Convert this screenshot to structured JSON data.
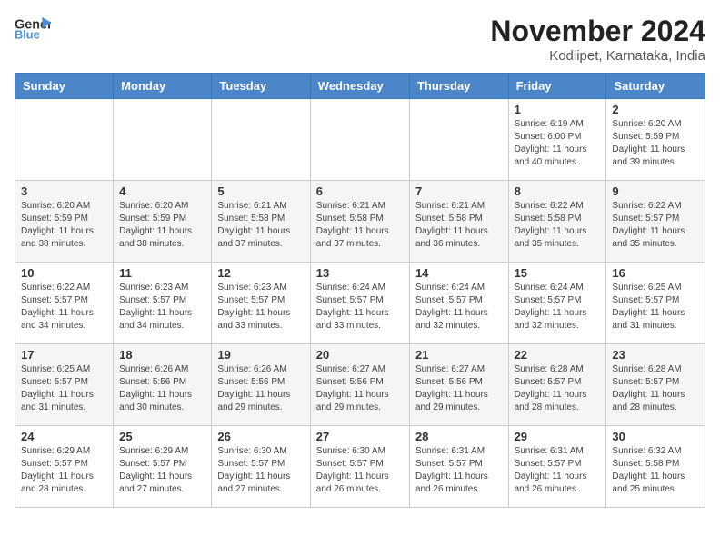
{
  "logo": {
    "general": "General",
    "blue": "Blue"
  },
  "title": "November 2024",
  "subtitle": "Kodlipet, Karnataka, India",
  "weekdays": [
    "Sunday",
    "Monday",
    "Tuesday",
    "Wednesday",
    "Thursday",
    "Friday",
    "Saturday"
  ],
  "weeks": [
    [
      {
        "day": "",
        "info": ""
      },
      {
        "day": "",
        "info": ""
      },
      {
        "day": "",
        "info": ""
      },
      {
        "day": "",
        "info": ""
      },
      {
        "day": "",
        "info": ""
      },
      {
        "day": "1",
        "info": "Sunrise: 6:19 AM\nSunset: 6:00 PM\nDaylight: 11 hours\nand 40 minutes."
      },
      {
        "day": "2",
        "info": "Sunrise: 6:20 AM\nSunset: 5:59 PM\nDaylight: 11 hours\nand 39 minutes."
      }
    ],
    [
      {
        "day": "3",
        "info": "Sunrise: 6:20 AM\nSunset: 5:59 PM\nDaylight: 11 hours\nand 38 minutes."
      },
      {
        "day": "4",
        "info": "Sunrise: 6:20 AM\nSunset: 5:59 PM\nDaylight: 11 hours\nand 38 minutes."
      },
      {
        "day": "5",
        "info": "Sunrise: 6:21 AM\nSunset: 5:58 PM\nDaylight: 11 hours\nand 37 minutes."
      },
      {
        "day": "6",
        "info": "Sunrise: 6:21 AM\nSunset: 5:58 PM\nDaylight: 11 hours\nand 37 minutes."
      },
      {
        "day": "7",
        "info": "Sunrise: 6:21 AM\nSunset: 5:58 PM\nDaylight: 11 hours\nand 36 minutes."
      },
      {
        "day": "8",
        "info": "Sunrise: 6:22 AM\nSunset: 5:58 PM\nDaylight: 11 hours\nand 35 minutes."
      },
      {
        "day": "9",
        "info": "Sunrise: 6:22 AM\nSunset: 5:57 PM\nDaylight: 11 hours\nand 35 minutes."
      }
    ],
    [
      {
        "day": "10",
        "info": "Sunrise: 6:22 AM\nSunset: 5:57 PM\nDaylight: 11 hours\nand 34 minutes."
      },
      {
        "day": "11",
        "info": "Sunrise: 6:23 AM\nSunset: 5:57 PM\nDaylight: 11 hours\nand 34 minutes."
      },
      {
        "day": "12",
        "info": "Sunrise: 6:23 AM\nSunset: 5:57 PM\nDaylight: 11 hours\nand 33 minutes."
      },
      {
        "day": "13",
        "info": "Sunrise: 6:24 AM\nSunset: 5:57 PM\nDaylight: 11 hours\nand 33 minutes."
      },
      {
        "day": "14",
        "info": "Sunrise: 6:24 AM\nSunset: 5:57 PM\nDaylight: 11 hours\nand 32 minutes."
      },
      {
        "day": "15",
        "info": "Sunrise: 6:24 AM\nSunset: 5:57 PM\nDaylight: 11 hours\nand 32 minutes."
      },
      {
        "day": "16",
        "info": "Sunrise: 6:25 AM\nSunset: 5:57 PM\nDaylight: 11 hours\nand 31 minutes."
      }
    ],
    [
      {
        "day": "17",
        "info": "Sunrise: 6:25 AM\nSunset: 5:57 PM\nDaylight: 11 hours\nand 31 minutes."
      },
      {
        "day": "18",
        "info": "Sunrise: 6:26 AM\nSunset: 5:56 PM\nDaylight: 11 hours\nand 30 minutes."
      },
      {
        "day": "19",
        "info": "Sunrise: 6:26 AM\nSunset: 5:56 PM\nDaylight: 11 hours\nand 29 minutes."
      },
      {
        "day": "20",
        "info": "Sunrise: 6:27 AM\nSunset: 5:56 PM\nDaylight: 11 hours\nand 29 minutes."
      },
      {
        "day": "21",
        "info": "Sunrise: 6:27 AM\nSunset: 5:56 PM\nDaylight: 11 hours\nand 29 minutes."
      },
      {
        "day": "22",
        "info": "Sunrise: 6:28 AM\nSunset: 5:57 PM\nDaylight: 11 hours\nand 28 minutes."
      },
      {
        "day": "23",
        "info": "Sunrise: 6:28 AM\nSunset: 5:57 PM\nDaylight: 11 hours\nand 28 minutes."
      }
    ],
    [
      {
        "day": "24",
        "info": "Sunrise: 6:29 AM\nSunset: 5:57 PM\nDaylight: 11 hours\nand 28 minutes."
      },
      {
        "day": "25",
        "info": "Sunrise: 6:29 AM\nSunset: 5:57 PM\nDaylight: 11 hours\nand 27 minutes."
      },
      {
        "day": "26",
        "info": "Sunrise: 6:30 AM\nSunset: 5:57 PM\nDaylight: 11 hours\nand 27 minutes."
      },
      {
        "day": "27",
        "info": "Sunrise: 6:30 AM\nSunset: 5:57 PM\nDaylight: 11 hours\nand 26 minutes."
      },
      {
        "day": "28",
        "info": "Sunrise: 6:31 AM\nSunset: 5:57 PM\nDaylight: 11 hours\nand 26 minutes."
      },
      {
        "day": "29",
        "info": "Sunrise: 6:31 AM\nSunset: 5:57 PM\nDaylight: 11 hours\nand 26 minutes."
      },
      {
        "day": "30",
        "info": "Sunrise: 6:32 AM\nSunset: 5:58 PM\nDaylight: 11 hours\nand 25 minutes."
      }
    ]
  ]
}
